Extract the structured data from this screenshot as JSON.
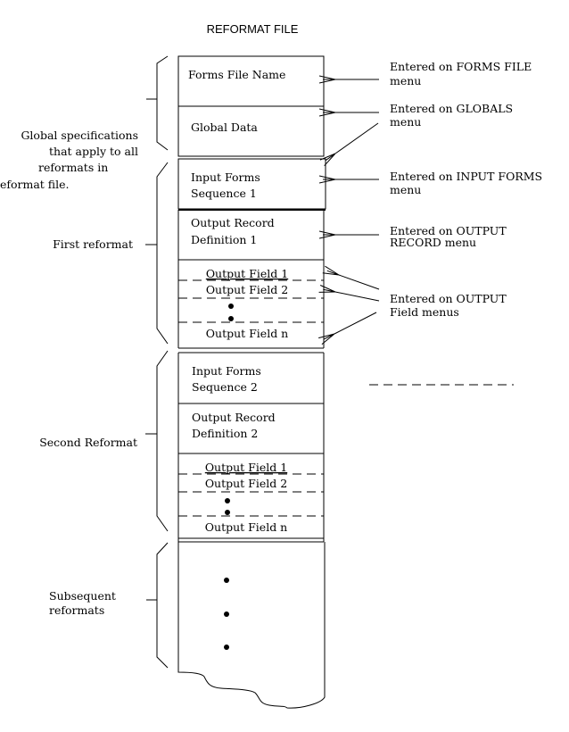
{
  "title": "REFORMAT FILE",
  "boxes": {
    "forms_file_name": "Forms File Name",
    "global_data": "Global Data",
    "input_forms_1": [
      "Input Forms",
      "Sequence 1"
    ],
    "output_record_1": [
      "Output Record",
      "Definition 1"
    ],
    "output_fields_1": [
      "Output Field 1",
      "Output Field 2",
      "Output Field n"
    ],
    "input_forms_2": [
      "Input Forms",
      "Sequence 2"
    ],
    "output_record_2": [
      "Output Record",
      "Definition 2"
    ],
    "output_fields_2": [
      "Output Field 1",
      "Output Field 2",
      "Output Field n"
    ]
  },
  "left_labels": {
    "global": [
      "Global specifications",
      "that apply to all",
      "reformats in",
      "reformat file."
    ],
    "first": "First reformat",
    "second": "Second Reformat",
    "subsequent": [
      "Subsequent",
      "reformats"
    ]
  },
  "right_labels": {
    "forms_file": [
      "Entered on FORMS FILE",
      "menu"
    ],
    "globals": [
      "Entered on GLOBALS",
      "menu"
    ],
    "input_forms": [
      "Entered on INPUT FORMS",
      "menu"
    ],
    "output_record": [
      "Entered on OUTPUT",
      "RECORD menu"
    ],
    "output_field": [
      "Entered on OUTPUT",
      "Field menus"
    ]
  }
}
